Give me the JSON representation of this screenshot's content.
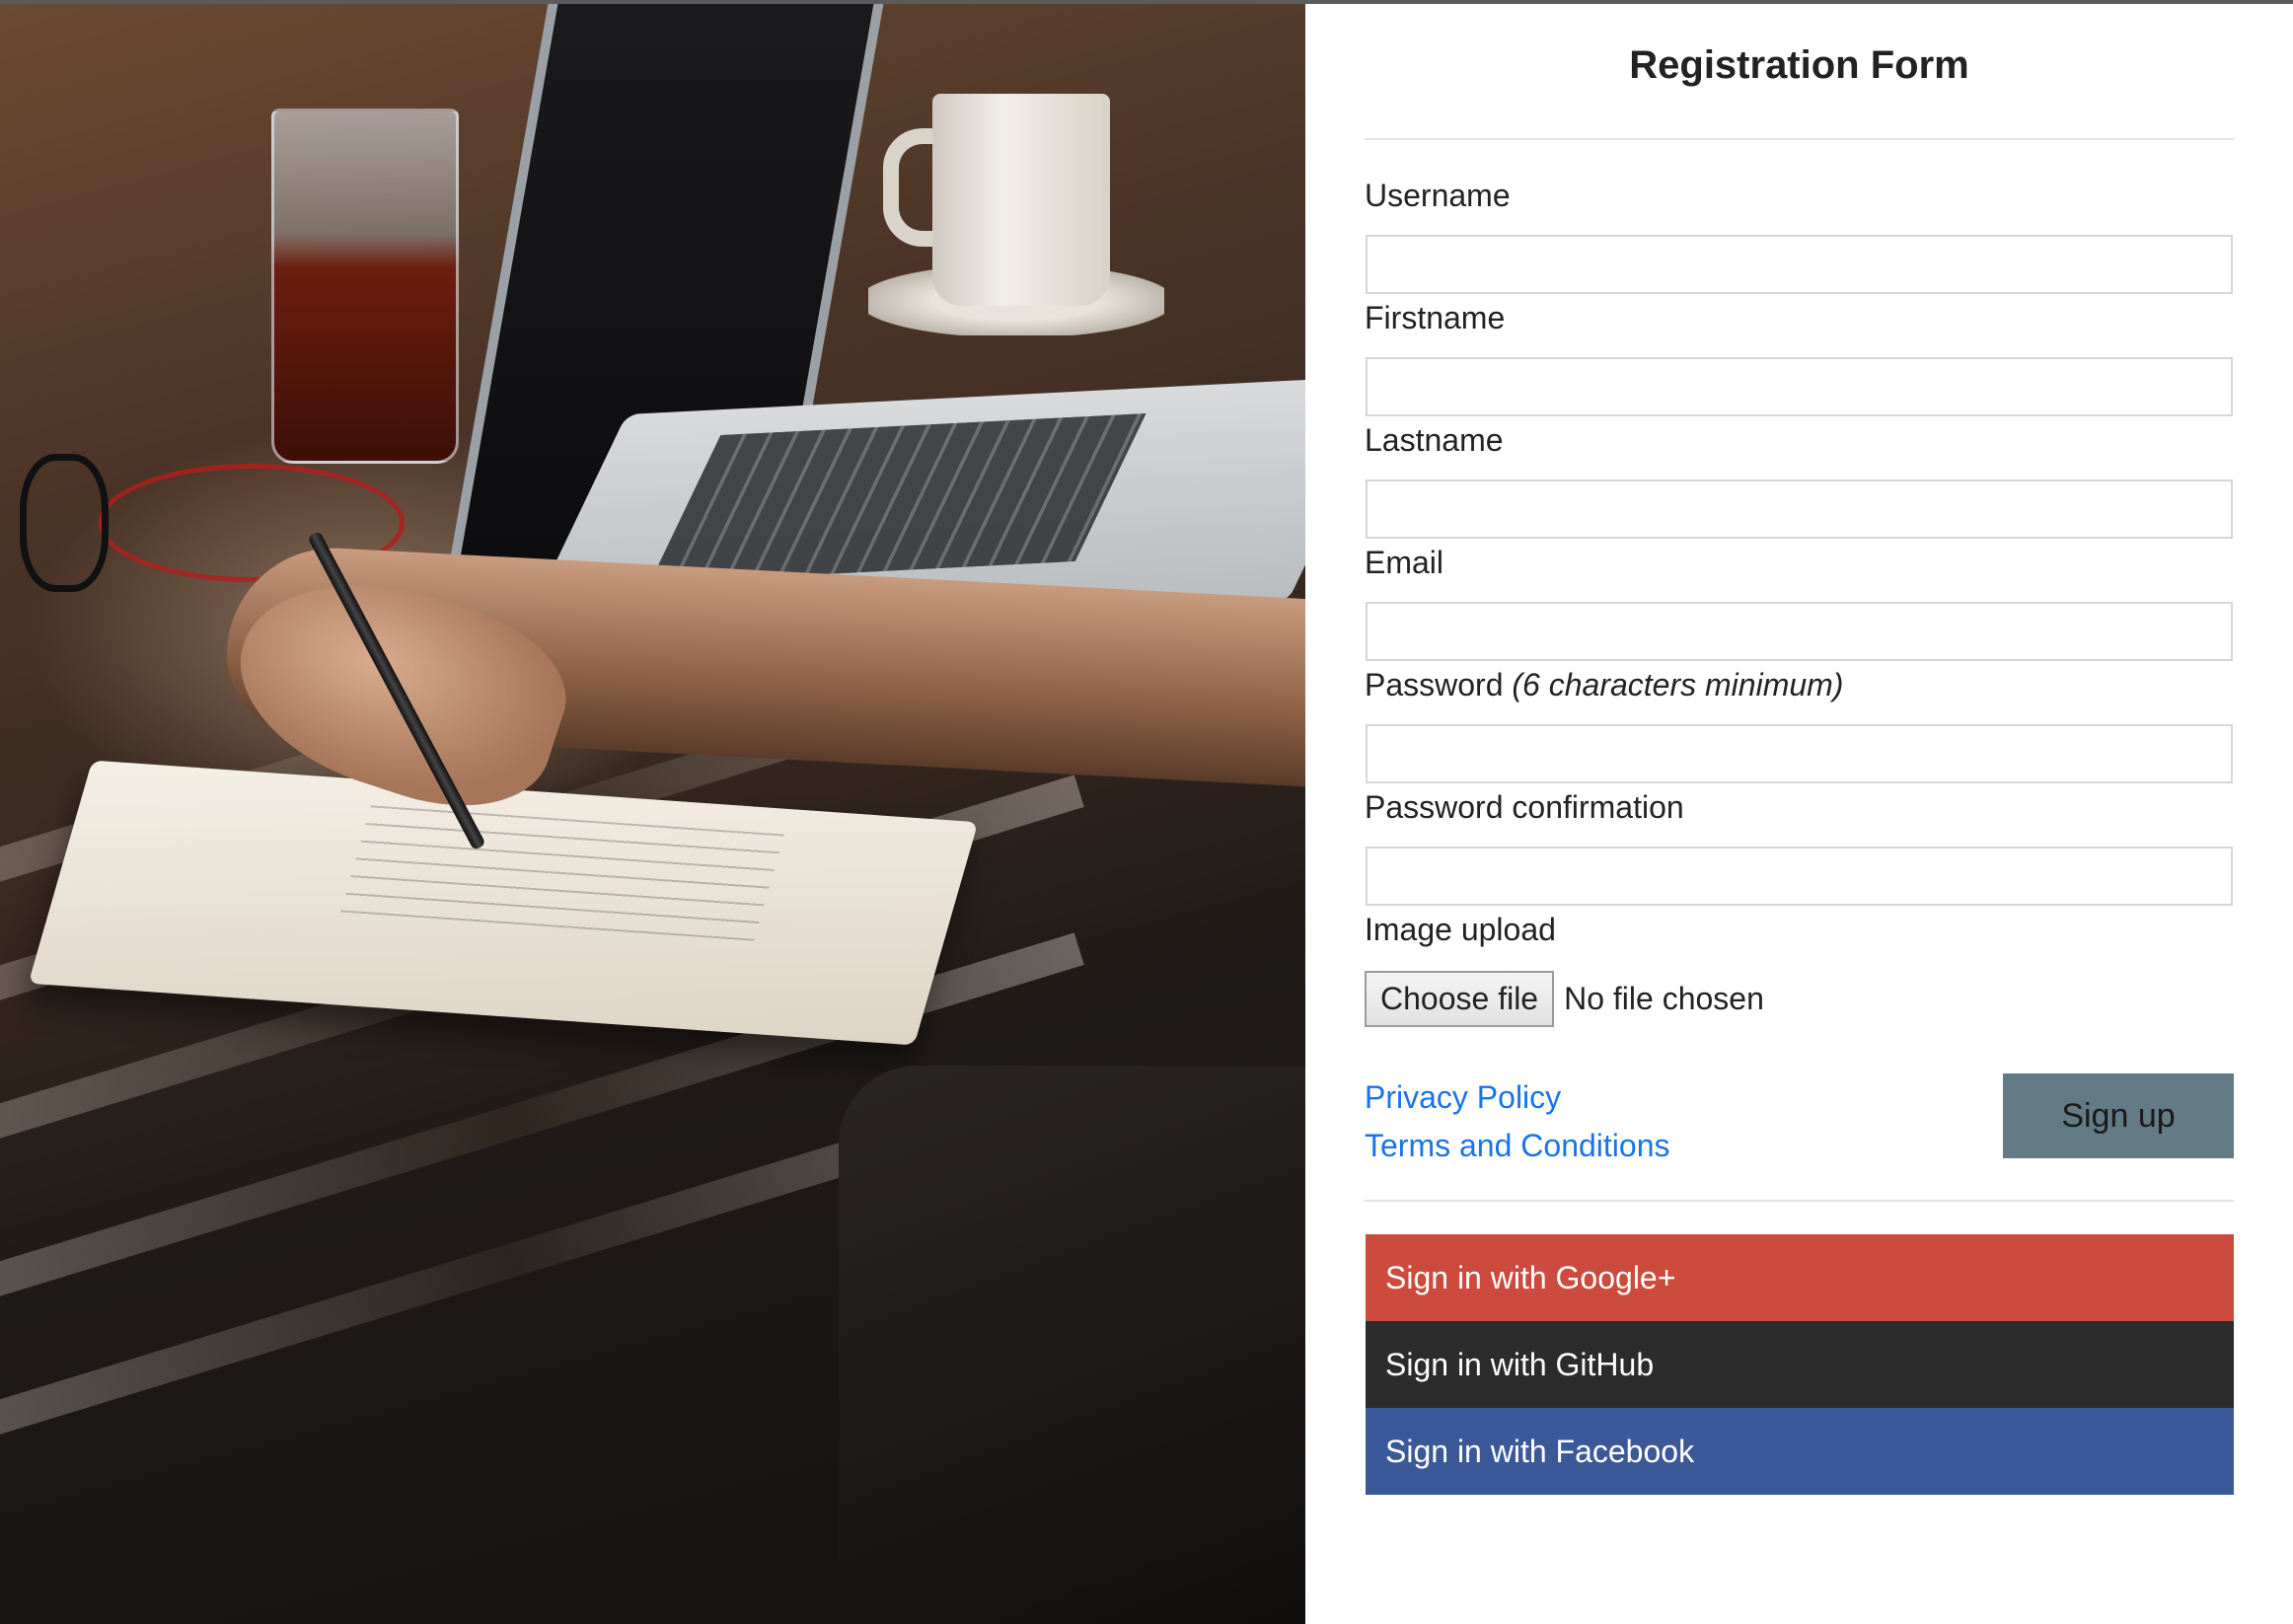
{
  "form": {
    "title": "Registration Form",
    "fields": [
      {
        "label": "Username",
        "value": "",
        "placeholder": ""
      },
      {
        "label": "Firstname",
        "value": "",
        "placeholder": ""
      },
      {
        "label": "Lastname",
        "value": "",
        "placeholder": ""
      },
      {
        "label": "Email",
        "value": "",
        "placeholder": ""
      },
      {
        "label": "Password",
        "hint": "(6 characters minimum)",
        "value": "",
        "placeholder": ""
      },
      {
        "label": "Password confirmation",
        "value": "",
        "placeholder": ""
      }
    ],
    "image_upload": {
      "label": "Image upload",
      "button_label": "Choose file",
      "status": "No file chosen"
    },
    "links": {
      "privacy": "Privacy Policy",
      "terms": "Terms and Conditions"
    },
    "submit_label": "Sign up"
  },
  "social": [
    {
      "label": "Sign in with Google+",
      "color": "#cc4b3c"
    },
    {
      "label": "Sign in with GitHub",
      "color": "#2c2c2c"
    },
    {
      "label": "Sign in with Facebook",
      "color": "#3b5998"
    }
  ],
  "colors": {
    "link": "#1a73e8",
    "submit_button": "#637b87",
    "divider": "#e3e3e3"
  },
  "photo": {
    "icon": "workspace-photo"
  }
}
